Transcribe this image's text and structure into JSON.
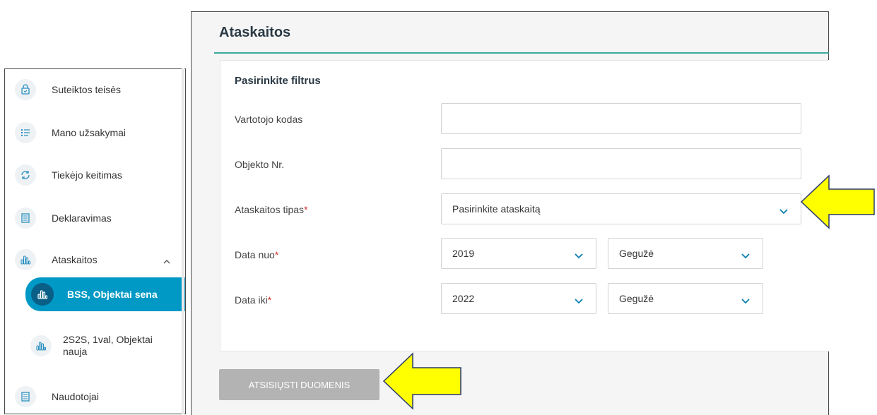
{
  "header": {
    "title": "Ataskaitos"
  },
  "sidebar": {
    "items": [
      {
        "label": "Suteiktos teisės",
        "icon": "lock-document-icon"
      },
      {
        "label": "Mano užsakymai",
        "icon": "list-icon"
      },
      {
        "label": "Tiekėjo keitimas",
        "icon": "refresh-icon"
      },
      {
        "label": "Deklaravimas",
        "icon": "document-icon"
      },
      {
        "label": "Ataskaitos",
        "icon": "bar-chart-icon",
        "expanded": true
      },
      {
        "label": "BSS, Objektai sena",
        "icon": "bar-chart-icon",
        "active": true
      },
      {
        "label": "2S2S, 1val, Objektai naujа",
        "icon": "bar-chart-icon"
      },
      {
        "label": "Naudotojai",
        "icon": "document-icon"
      }
    ]
  },
  "filters": {
    "title": "Pasirinkite filtrus",
    "user_code": {
      "label": "Vartotojo kodas",
      "value": ""
    },
    "object_no": {
      "label": "Objekto Nr.",
      "value": ""
    },
    "report_type": {
      "label": "Ataskaitos tipas",
      "required_mark": "*",
      "value": "Pasirinkite ataskaitą"
    },
    "date_from": {
      "label": "Data nuo",
      "required_mark": "*",
      "year": "2019",
      "month": "Gegužė"
    },
    "date_to": {
      "label": "Data iki",
      "required_mark": "*",
      "year": "2022",
      "month": "Gegužė"
    }
  },
  "actions": {
    "download_label": "ATSISIŲSTI DUOMENIS"
  },
  "colors": {
    "accent": "#0099c6",
    "teal_line": "#3aa99f",
    "arrow": "#ffff00",
    "button_disabled": "#b3b3b3"
  }
}
